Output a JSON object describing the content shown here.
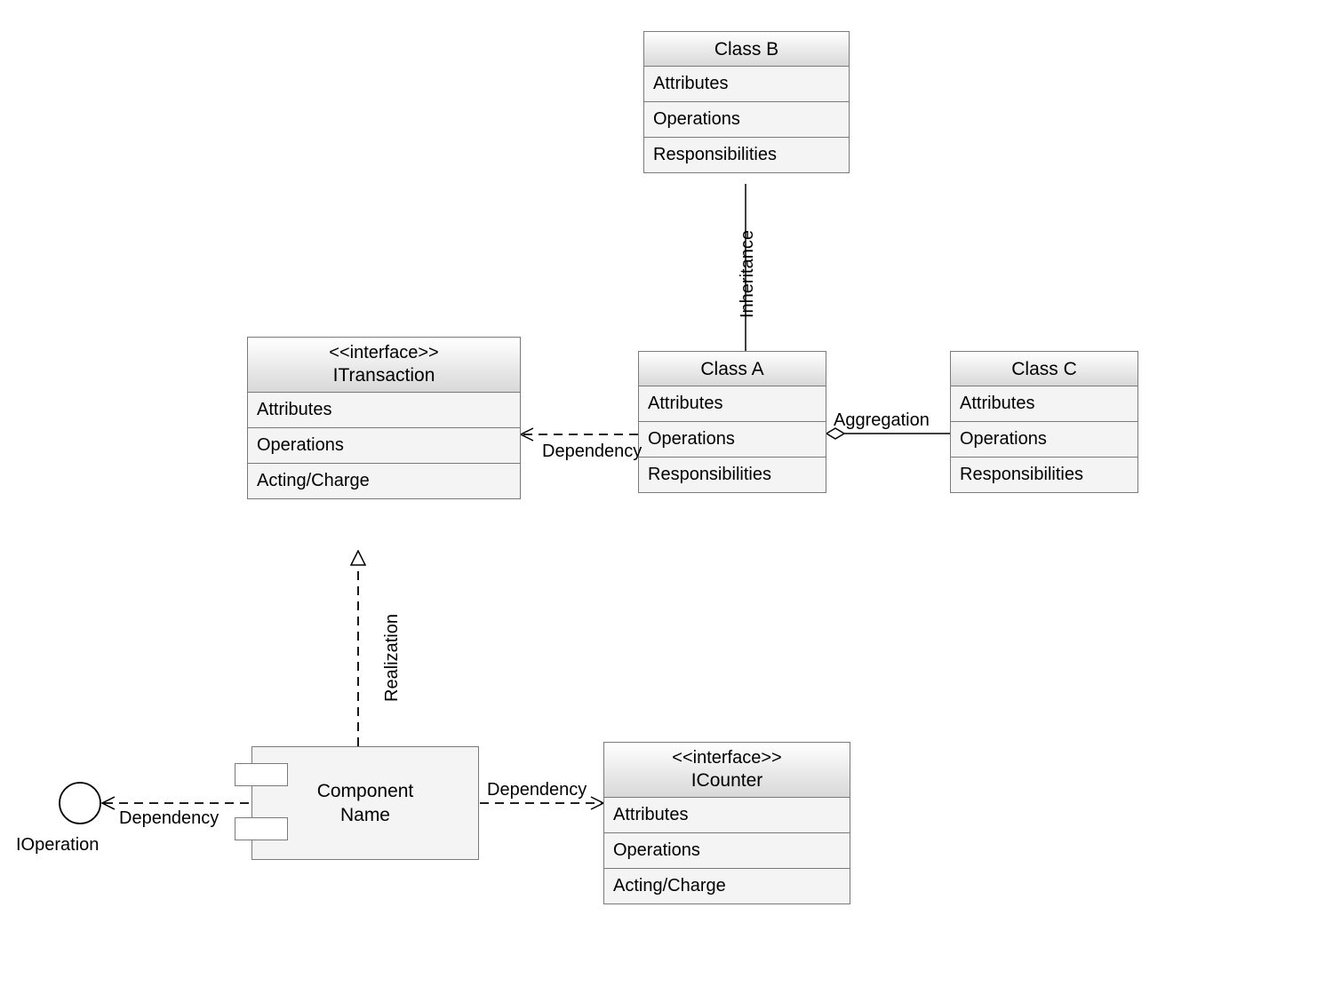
{
  "classes": {
    "classB": {
      "title": "Class B",
      "rows": [
        "Attributes",
        "Operations",
        "Responsibilities"
      ]
    },
    "classA": {
      "title": "Class A",
      "rows": [
        "Attributes",
        "Operations",
        "Responsibilities"
      ]
    },
    "classC": {
      "title": "Class C",
      "rows": [
        "Attributes",
        "Operations",
        "Responsibilities"
      ]
    },
    "iTransaction": {
      "stereo": "<<interface>>",
      "title": "ITransaction",
      "rows": [
        "Attributes",
        "Operations",
        "Acting/Charge"
      ]
    },
    "iCounter": {
      "stereo": "<<interface>>",
      "title": "ICounter",
      "rows": [
        "Attributes",
        "Operations",
        "Acting/Charge"
      ]
    }
  },
  "component": {
    "line1": "Component",
    "line2": "Name"
  },
  "lollipop": {
    "label": "IOperation"
  },
  "edgeLabels": {
    "inheritance": "Inheritance",
    "aggregation": "Aggregation",
    "dependency_a_to_itrans": "Dependency",
    "realization": "Realization",
    "dependency_comp_to_icounter": "Dependency",
    "dependency_comp_to_iop": "Dependency"
  }
}
